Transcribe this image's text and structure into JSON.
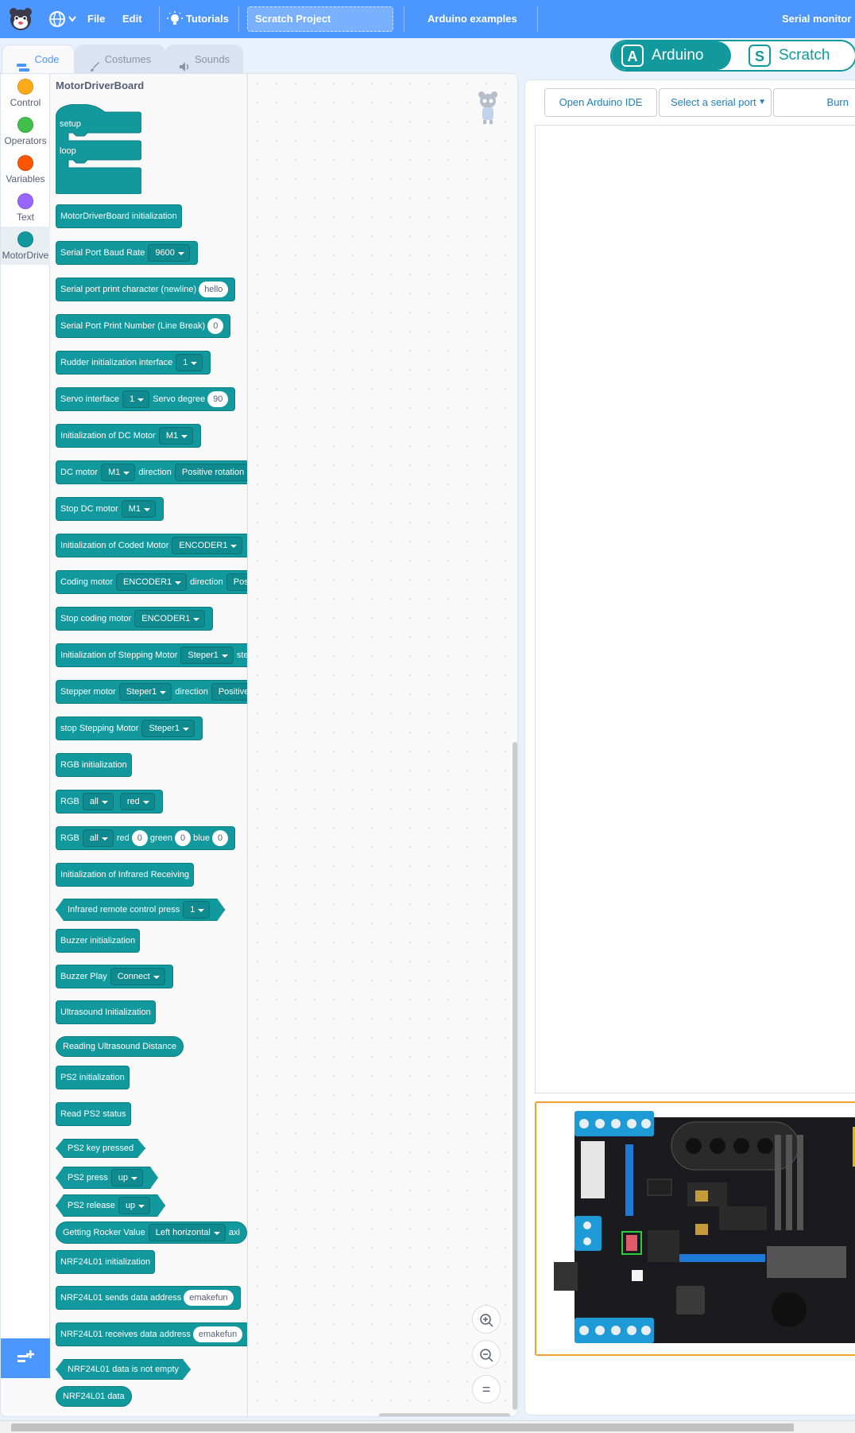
{
  "menubar": {
    "file": "File",
    "edit": "Edit",
    "tutorials": "Tutorials",
    "project_title": "Scratch Project",
    "arduino_examples": "Arduino examples",
    "serial_monitor": "Serial monitor"
  },
  "tabs": {
    "code": "Code",
    "costumes": "Costumes",
    "sounds": "Sounds"
  },
  "categories": [
    {
      "label": "Control",
      "color": "#ffab19"
    },
    {
      "label": "Operators",
      "color": "#40bf4a"
    },
    {
      "label": "Variables",
      "color": "#ff5500"
    },
    {
      "label": "Text",
      "color": "#9966ff"
    },
    {
      "label": "MotorDrive",
      "color": "#11999e"
    }
  ],
  "flyout": {
    "title": "MotorDriverBoard",
    "setup": "setup",
    "loop": "loop",
    "blocks": {
      "init": "MotorDriverBoard initialization",
      "baud_label": "Serial Port Baud Rate",
      "baud_value": "9600",
      "print_char_label": "Serial port print character (newline)",
      "print_char_value": "hello",
      "print_num_label": "Serial Port Print Number (Line Break)",
      "print_num_value": "0",
      "rudder_label": "Rudder initialization  interface",
      "rudder_value": "1",
      "servo_label": "Servo interface",
      "servo_value": "1",
      "servo_degree_label": "Servo degree",
      "servo_degree_value": "90",
      "dc_init_label": "Initialization of DC Motor",
      "dc_init_value": "M1",
      "dc_motor_label": "DC motor",
      "dc_motor_value": "M1",
      "dc_dir_label": "direction",
      "dc_dir_value": "Positive rotation",
      "stop_dc_label": "Stop DC motor",
      "stop_dc_value": "M1",
      "coded_init_label": "Initialization of Coded Motor",
      "coded_init_value": "ENCODER1",
      "coding_label": "Coding motor",
      "coding_value": "ENCODER1",
      "coding_dir_label": "direction",
      "coding_dir_value": "Pos",
      "stop_coding_label": "Stop coding motor",
      "stop_coding_value": "ENCODER1",
      "step_init_label": "Initialization of Stepping Motor",
      "step_init_value": "Steper1",
      "step_init_tail": "ste",
      "stepper_label": "Stepper motor",
      "stepper_value": "Steper1",
      "stepper_dir_label": "direction",
      "stepper_dir_value": "Positive",
      "stop_step_label": "stop Stepping Motor",
      "stop_step_value": "Steper1",
      "rgb_init": "RGB initialization",
      "rgb1_label": "RGB",
      "rgb1_all": "all",
      "rgb1_color": "red",
      "rgb2_label": "RGB",
      "rgb2_all": "all",
      "rgb2_red_label": "red",
      "rgb2_red_value": "0",
      "rgb2_green_label": "green",
      "rgb2_green_value": "0",
      "rgb2_blue_label": "blue",
      "rgb2_blue_value": "0",
      "ir_init": "Initialization of Infrared Receiving",
      "ir_press_label": "Infrared remote control press",
      "ir_press_value": "1",
      "buzzer_init": "Buzzer initialization",
      "buzzer_play_label": "Buzzer Play",
      "buzzer_play_value": "Connect",
      "ultra_init": "Ultrasound Initialization",
      "ultra_read": "Reading Ultrasound Distance",
      "ps2_init": "PS2 initialization",
      "ps2_status": "Read PS2 status",
      "ps2_key": "PS2 key pressed",
      "ps2_press_label": "PS2 press",
      "ps2_press_value": "up",
      "ps2_release_label": "PS2 release",
      "ps2_release_value": "up",
      "rocker_label": "Getting Rocker Value",
      "rocker_value": "Left horizontal",
      "rocker_tail": "axi",
      "nrf_init": "NRF24L01 initialization",
      "nrf_send_label": "NRF24L01 sends data  address",
      "nrf_send_value": "emakefun",
      "nrf_recv_label": "NRF24L01 receives data  address",
      "nrf_recv_value": "emakefun",
      "nrf_empty": "NRF24L01 data is not empty",
      "nrf_data": "NRF24L01 data"
    }
  },
  "mode_switch": {
    "arduino": "Arduino",
    "scratch": "Scratch",
    "arduino_icon": "A",
    "scratch_icon": "S"
  },
  "right_toolbar": {
    "open_ide": "Open Arduino IDE",
    "serial_port": "Select a serial port",
    "burn": "Burn"
  },
  "zoom": {
    "zoom_in": "+",
    "zoom_out": "−",
    "reset": "="
  },
  "colors": {
    "menubar": "#4c97ff",
    "block": "#11999e",
    "board_frame": "#f0a030"
  }
}
